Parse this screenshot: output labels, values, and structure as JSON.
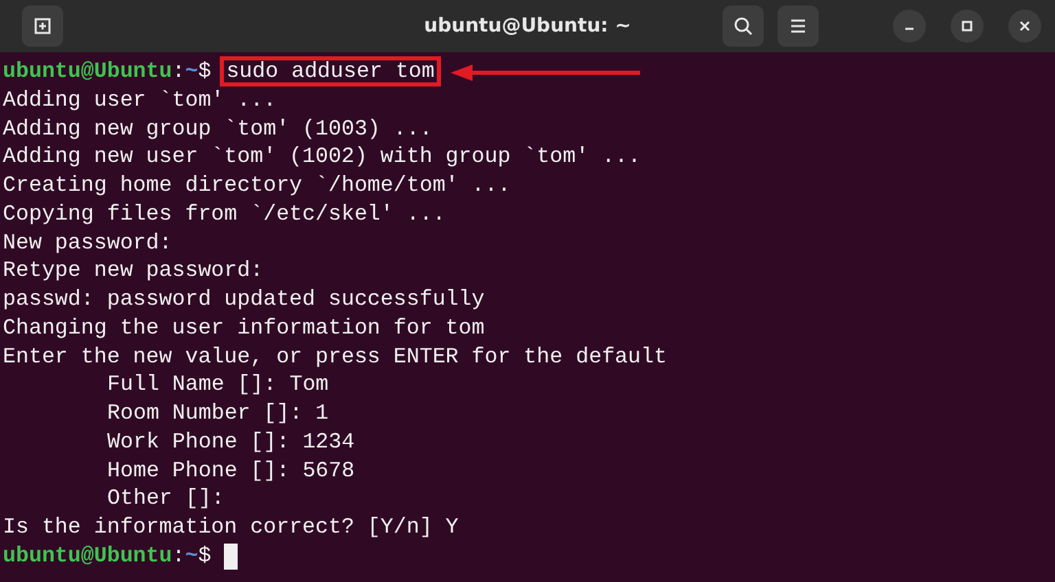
{
  "window": {
    "title": "ubuntu@Ubuntu: ~"
  },
  "terminal": {
    "lines": [
      {
        "kind": "prompt",
        "user_host": "ubuntu@Ubuntu",
        "separator": ":",
        "path": "~",
        "symbol": "$",
        "command": "sudo adduser tom",
        "highlighted": true
      },
      {
        "kind": "output",
        "text": "Adding user `tom' ...",
        "indented": false
      },
      {
        "kind": "output",
        "text": "Adding new group `tom' (1003) ...",
        "indented": false
      },
      {
        "kind": "output",
        "text": "Adding new user `tom' (1002) with group `tom' ...",
        "indented": false
      },
      {
        "kind": "output",
        "text": "Creating home directory `/home/tom' ...",
        "indented": false
      },
      {
        "kind": "output",
        "text": "Copying files from `/etc/skel' ...",
        "indented": false
      },
      {
        "kind": "output",
        "text": "New password:",
        "indented": false
      },
      {
        "kind": "output",
        "text": "Retype new password:",
        "indented": false
      },
      {
        "kind": "output",
        "text": "passwd: password updated successfully",
        "indented": false
      },
      {
        "kind": "output",
        "text": "Changing the user information for tom",
        "indented": false
      },
      {
        "kind": "output",
        "text": "Enter the new value, or press ENTER for the default",
        "indented": false
      },
      {
        "kind": "output",
        "text": "Full Name []: Tom",
        "indented": true
      },
      {
        "kind": "output",
        "text": "Room Number []: 1",
        "indented": true
      },
      {
        "kind": "output",
        "text": "Work Phone []: 1234",
        "indented": true
      },
      {
        "kind": "output",
        "text": "Home Phone []: 5678",
        "indented": true
      },
      {
        "kind": "output",
        "text": "Other []:",
        "indented": true
      },
      {
        "kind": "output",
        "text": "Is the information correct? [Y/n] Y",
        "indented": false
      },
      {
        "kind": "prompt",
        "user_host": "ubuntu@Ubuntu",
        "separator": ":",
        "path": "~",
        "symbol": "$",
        "cursor": true
      }
    ]
  }
}
